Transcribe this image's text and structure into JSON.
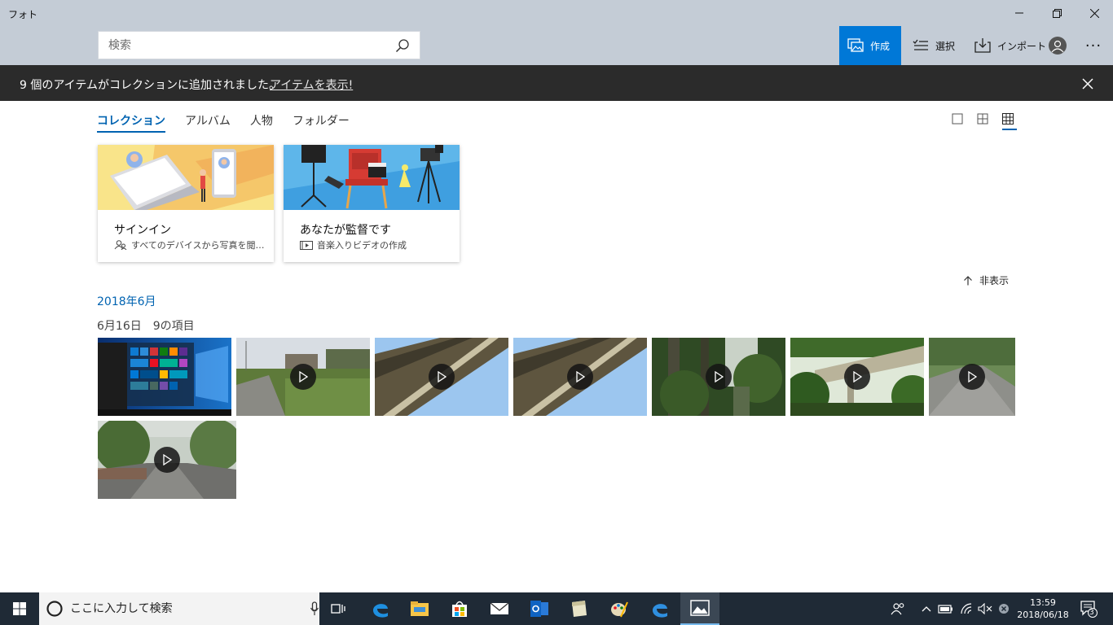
{
  "window": {
    "title": "フォト"
  },
  "search": {
    "placeholder": "検索"
  },
  "toolbar": {
    "create_label": "作成",
    "select_label": "選択",
    "import_label": "インポート",
    "more_label": "···"
  },
  "notification": {
    "message": "9 個のアイテムがコレクションに追加されました。",
    "link": "アイテムを表示!"
  },
  "tabs": [
    {
      "label": "コレクション",
      "active": true
    },
    {
      "label": "アルバム",
      "active": false
    },
    {
      "label": "人物",
      "active": false
    },
    {
      "label": "フォルダー",
      "active": false
    }
  ],
  "cards": [
    {
      "title": "サインイン",
      "subtitle": "すべてのデバイスから写真を閲…",
      "icon": "people-icon"
    },
    {
      "title": "あなたが監督です",
      "subtitle": "音楽入りビデオの作成",
      "icon": "video-icon"
    }
  ],
  "hide_label": "非表示",
  "month_heading": "2018年6月",
  "day_group": {
    "date": "6月16日",
    "count": "9の項目"
  },
  "thumbnails": [
    {
      "kind": "screenshot",
      "video": false
    },
    {
      "kind": "rice-field",
      "video": true
    },
    {
      "kind": "bridge-sky",
      "video": true
    },
    {
      "kind": "bridge-sky",
      "video": true
    },
    {
      "kind": "forest",
      "video": true
    },
    {
      "kind": "bridge-trees",
      "video": true
    },
    {
      "kind": "road-blur",
      "video": true
    },
    {
      "kind": "road-trees",
      "video": true
    }
  ],
  "taskbar": {
    "search_placeholder": "ここに入力して検索",
    "time": "13:59",
    "date": "2018/06/18",
    "notification_count": "3"
  },
  "colors": {
    "accent": "#0078d7",
    "titlebar": "#c4ccd6",
    "notification_bar": "#2b2b2b",
    "taskbar": "#1f2a36"
  }
}
